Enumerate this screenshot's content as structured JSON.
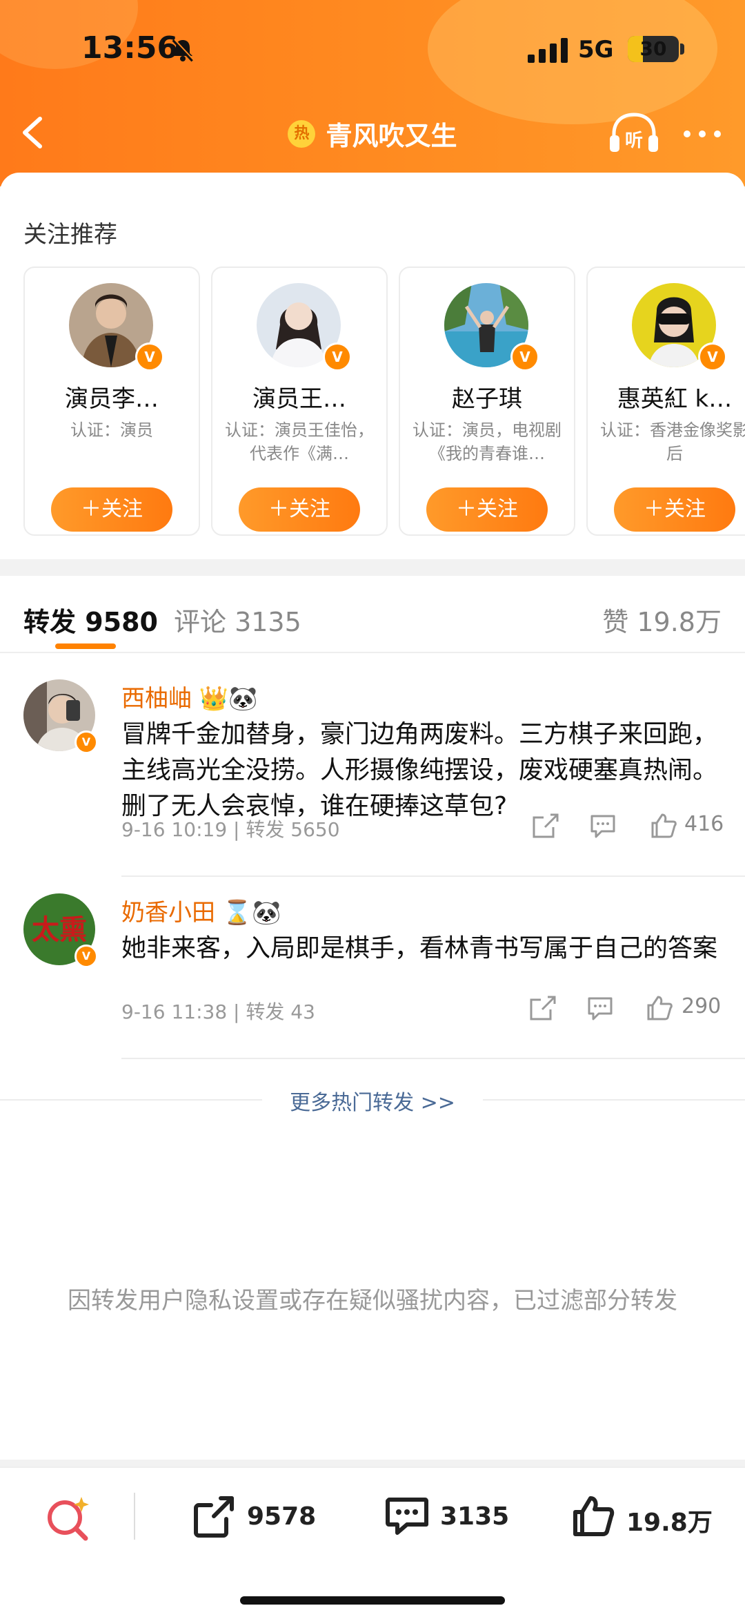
{
  "status": {
    "time": "13:56",
    "network": "5G",
    "battery": "30",
    "battery_level": 0.3
  },
  "nav": {
    "title": "青风吹又生",
    "title_badge": "热"
  },
  "recommend": {
    "label": "关注推荐",
    "cards": [
      {
        "name": "演员李…",
        "desc": "认证：演员",
        "button": "＋关注"
      },
      {
        "name": "演员王…",
        "desc": "认证：演员王佳怡，代表作《满…",
        "button": "＋关注"
      },
      {
        "name": "赵子琪",
        "desc": "认证：演员，电视剧《我的青春谁…",
        "button": "＋关注"
      },
      {
        "name": "惠英紅 k…",
        "desc": "认证：香港金像奖影后",
        "button": "＋关注"
      }
    ]
  },
  "tabs": {
    "repost": "转发 9580",
    "comment": "评论 3135",
    "like": "赞 19.8万"
  },
  "posts": [
    {
      "user": "西柚岫",
      "badges": "👑🐼",
      "text": "冒牌千金加替身，豪门边角两废料。三方棋子来回跑，主线高光全没捞。人形摄像纯摆设，废戏硬塞真热闹。删了无人会哀悼，谁在硬捧这草包?",
      "meta": "9-16 10:19 | 转发 5650",
      "likes": "416"
    },
    {
      "user": "奶香小田",
      "badges": "⌛🐼",
      "avatar_text": "太熏",
      "text": "她非来客，入局即是棋手，看林青书写属于自己的答案",
      "meta": "9-16 11:38 | 转发 43",
      "likes": "290"
    }
  ],
  "more_link": "更多热门转发 >>",
  "notice": "因转发用户隐私设置或存在疑似骚扰内容，已过滤部分转发",
  "bottom": {
    "reposts": "9578",
    "comments": "3135",
    "likes": "19.8万"
  },
  "colors": {
    "accent": "#ff8200",
    "username": "#e96a00",
    "link": "#4a6a96"
  }
}
